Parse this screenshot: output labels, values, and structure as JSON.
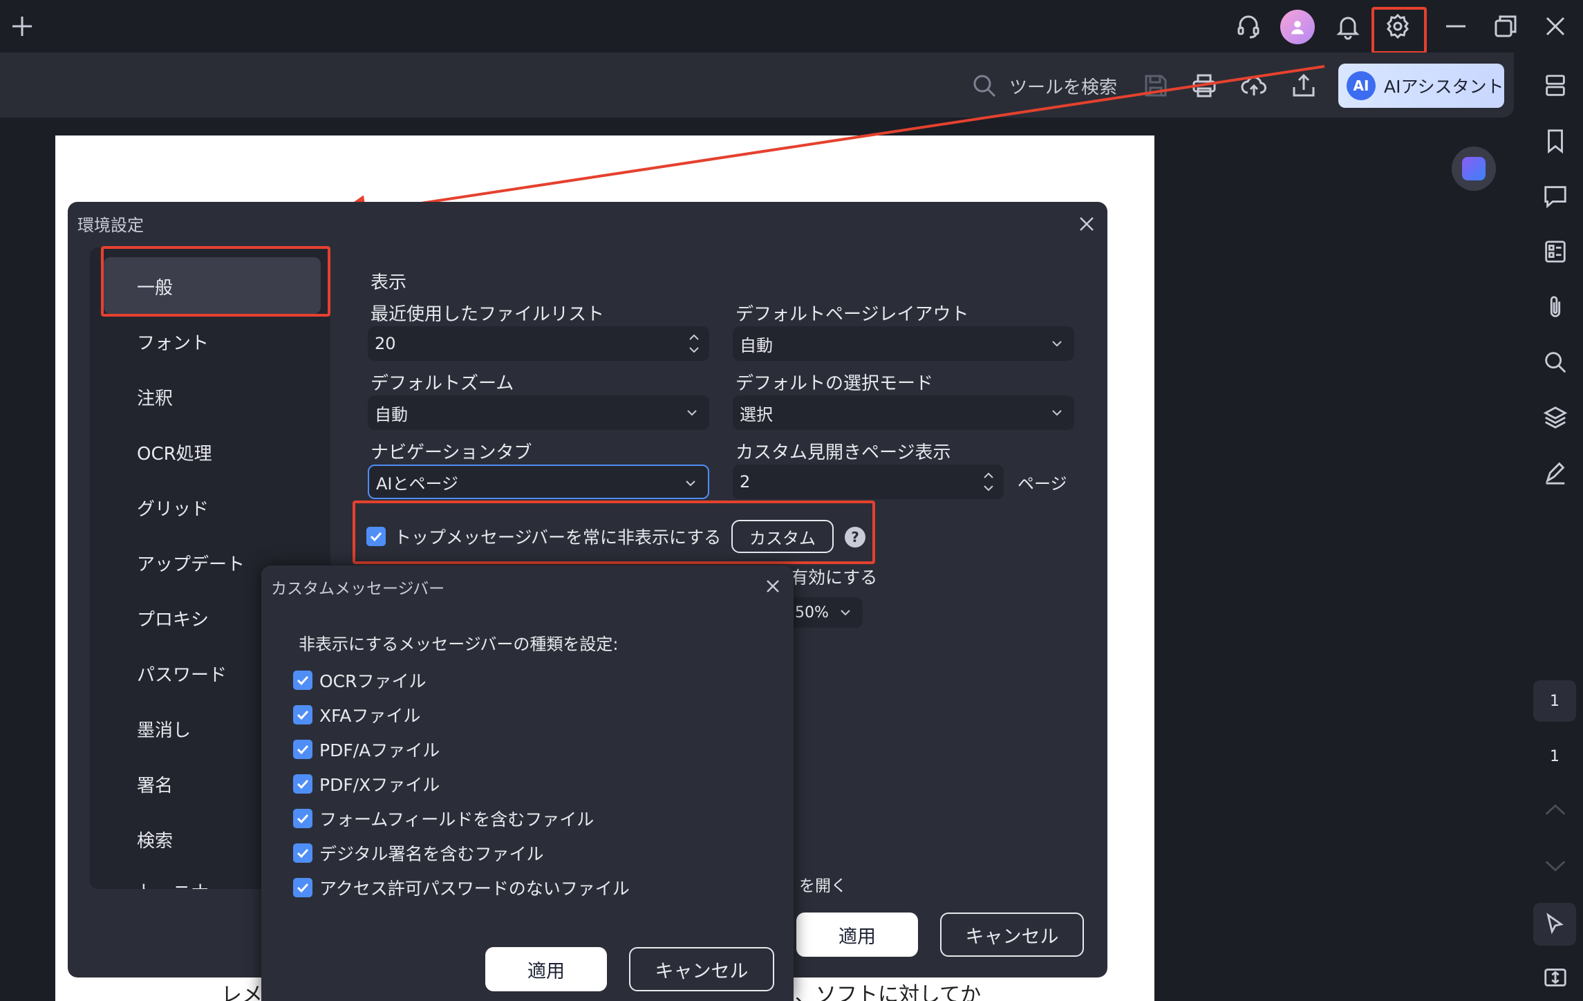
{
  "titlebar": {
    "icons": [
      "plus-icon",
      "headset-icon",
      "avatar",
      "bell-icon",
      "gear-icon",
      "minimize-icon",
      "restore-icon",
      "close-icon"
    ]
  },
  "toolbar": {
    "search_label": "ツールを検索",
    "ai_logo": "AI",
    "ai_assistant_label": "AIアシスタント"
  },
  "sidebar_right": {
    "page_current": "1",
    "page_total": "1"
  },
  "document": {
    "text_left": "レメ",
    "text_right": "、ソフトに対してか"
  },
  "settings": {
    "title": "環境設定",
    "nav": [
      "一般",
      "フォント",
      "注釈",
      "OCR処理",
      "グリッド",
      "アップデート",
      "プロキシ",
      "パスワード",
      "墨消し",
      "署名",
      "検索",
      "トーニナ"
    ],
    "section_display": "表示",
    "recent_files_label": "最近使用したファイルリスト",
    "recent_files_value": "20",
    "default_layout_label": "デフォルトページレイアウト",
    "default_layout_value": "自動",
    "default_zoom_label": "デフォルトズーム",
    "default_zoom_value": "自動",
    "default_select_label": "デフォルトの選択モード",
    "default_select_value": "選択",
    "nav_tab_label": "ナビゲーションタブ",
    "nav_tab_value": "AIとページ",
    "custom_heading_label": "カスタム見開きページ表示",
    "custom_heading_value": "2",
    "custom_heading_unit": "ページ",
    "hide_bar_label": "トップメッセージバーを常に非表示にする",
    "custom_button": "カスタム",
    "help": "?",
    "enable_partial": "有効にする",
    "percent_partial": "50%",
    "open_partial": "を開く",
    "apply": "適用",
    "cancel": "キャンセル"
  },
  "custom_popup": {
    "title": "カスタムメッセージバー",
    "prompt": "非表示にするメッセージバーの種類を設定:",
    "options": [
      "OCRファイル",
      "XFAファイル",
      "PDF/Aファイル",
      "PDF/Xファイル",
      "フォームフィールドを含むファイル",
      "デジタル署名を含むファイル",
      "アクセス許可パスワードのないファイル"
    ],
    "apply": "適用",
    "cancel": "キャンセル"
  },
  "colors": {
    "accent": "#4f8ef7",
    "highlight": "#e5412e"
  }
}
